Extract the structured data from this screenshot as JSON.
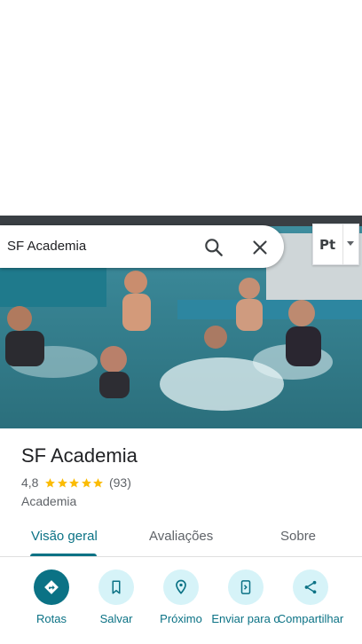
{
  "search": {
    "query": "SF Academia"
  },
  "language_selector": {
    "value": "Pt"
  },
  "place": {
    "name": "SF Academia",
    "rating": "4,8",
    "stars": 5,
    "review_count": "(93)",
    "category": "Academia"
  },
  "tabs": [
    {
      "label": "Visão geral",
      "active": true
    },
    {
      "label": "Avaliações",
      "active": false
    },
    {
      "label": "Sobre",
      "active": false
    }
  ],
  "actions": [
    {
      "label": "Rotas",
      "icon": "directions-icon"
    },
    {
      "label": "Salvar",
      "icon": "bookmark-icon"
    },
    {
      "label": "Próximo",
      "icon": "nearby-icon"
    },
    {
      "label": "Enviar para o",
      "icon": "send-to-phone-icon"
    },
    {
      "label": "Compartilhar",
      "icon": "share-icon"
    }
  ],
  "colors": {
    "accent": "#0b7285",
    "accent_light": "#d6f3f8",
    "star": "#fbbc04"
  }
}
